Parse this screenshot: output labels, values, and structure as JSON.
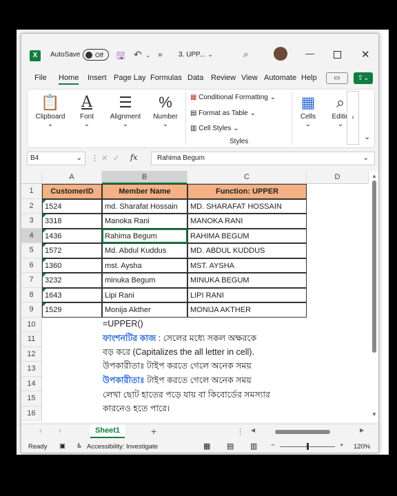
{
  "titlebar": {
    "autosave_label": "AutoSave",
    "toggle_state": "Off",
    "filename": "3. UPP...",
    "more": "»"
  },
  "tabs": [
    "File",
    "Home",
    "Insert",
    "Page Lay",
    "Formulas",
    "Data",
    "Review",
    "View",
    "Automate",
    "Help"
  ],
  "ribbon": {
    "clipboard": "Clipboard",
    "font": "Font",
    "alignment": "Alignment",
    "number": "Number",
    "conditional_formatting": "Conditional Formatting",
    "format_as_table": "Format as Table",
    "cell_styles": "Cell Styles",
    "styles_group": "Styles",
    "cells": "Cells",
    "editing": "Editin"
  },
  "formula_bar": {
    "name_box": "B4",
    "fx": "fx",
    "value": "Rahima Begum"
  },
  "columns": [
    "A",
    "B",
    "C",
    "D"
  ],
  "rows": [
    "1",
    "2",
    "3",
    "4",
    "5",
    "6",
    "7",
    "8",
    "9",
    "10",
    "11",
    "12",
    "13",
    "14",
    "15",
    "16"
  ],
  "table": {
    "headers": [
      "CustomerID",
      "Member Name",
      "Function: UPPER"
    ],
    "data": [
      [
        "1524",
        "md. Sharafat Hossain",
        "MD. SHARAFAT HOSSAIN"
      ],
      [
        "3318",
        "Manoka Rani",
        "MANOKA RANI"
      ],
      [
        "1436",
        "Rahima Begum",
        "RAHIMA BEGUM"
      ],
      [
        "1572",
        "Md. Abdul Kuddus",
        "MD. ABDUL KUDDUS"
      ],
      [
        "1360",
        "mst. Aysha",
        "MST. AYSHA"
      ],
      [
        "3232",
        "minuka Begum",
        "MINUKA BEGUM"
      ],
      [
        "1643",
        "Lipi Rani",
        "LIPI RANI"
      ],
      [
        "1529",
        "Monija Akther",
        "MONIJA AKTHER"
      ]
    ]
  },
  "notes": {
    "formula": "=UPPER()",
    "line1_label": "ফাংশনটির কাজ",
    "line1_text": " : সেলের মধ্যে সকল অক্ষরকে",
    "line2": "বড় করে (Capitalizes the all letter in cell).",
    "line3": "উপকারীতাঃ টাইপ করতে গেলে অনেক সময়",
    "line4_label": "উপকারীতাঃ",
    "line4_text": " টাইপ করতে গেলে অনেক সময়",
    "line5": "লেখা ছোট হাতের পড়ে যায় বা কিবোর্ডের সমস্যার",
    "line6": "কারনেও হতে পারে।"
  },
  "sheet_tab": "Sheet1",
  "status": {
    "ready": "Ready",
    "accessibility": "Accessibility: Investigate",
    "zoom": "120%"
  },
  "colors": {
    "accent": "#107c41",
    "header_fill": "#f4b183",
    "note_blue": "#2e6bd6"
  }
}
